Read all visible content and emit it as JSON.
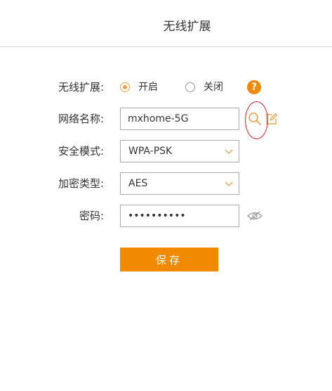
{
  "header": {
    "title": "无线扩展"
  },
  "form": {
    "extend": {
      "label": "无线扩展:",
      "option_on": "开启",
      "option_off": "关闭",
      "selected": "开启",
      "help_icon": "?"
    },
    "ssid": {
      "label": "网络名称:",
      "value": "mxhome-5G",
      "icons": [
        "search-icon",
        "edit-icon"
      ]
    },
    "security_mode": {
      "label": "安全模式:",
      "value": "WPA-PSK"
    },
    "encryption": {
      "label": "加密类型:",
      "value": "AES"
    },
    "password": {
      "label": "密码:",
      "value": "••••••••••",
      "icon": "eye-hidden-icon"
    }
  },
  "actions": {
    "save_label": "保存"
  },
  "colors": {
    "accent": "#f08a00",
    "radio_accent": "#e6a24a",
    "annotation": "#d21f26"
  }
}
